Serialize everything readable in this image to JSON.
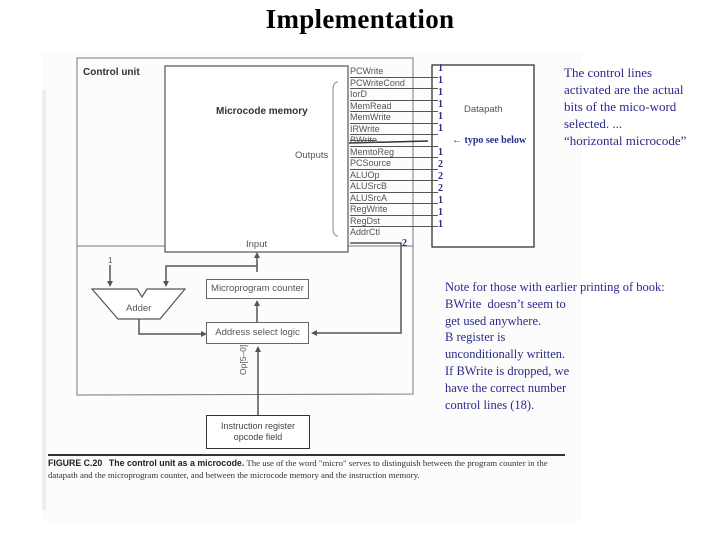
{
  "slide": {
    "title": "Implementation"
  },
  "diagram": {
    "control_unit_label": "Control unit",
    "microcode_memory_label": "Microcode memory",
    "outputs_label": "Outputs",
    "input_label": "Input",
    "datapath_label": "Datapath",
    "adder_label": "Adder",
    "adder_constant": "1",
    "microprogram_counter_label": "Microprogram counter",
    "address_select_label": "Address select logic",
    "opcode_bus_label": "Op[5–0]",
    "instruction_register_label_line1": "Instruction register",
    "instruction_register_label_line2": "opcode field",
    "addrctl_width": "2",
    "signals": [
      {
        "name": "PCWrite",
        "bits": "1",
        "struck": false
      },
      {
        "name": "PCWriteCond",
        "bits": "1",
        "struck": false
      },
      {
        "name": "IorD",
        "bits": "1",
        "struck": false
      },
      {
        "name": "MemRead",
        "bits": "1",
        "struck": false
      },
      {
        "name": "MemWrite",
        "bits": "1",
        "struck": false
      },
      {
        "name": "IRWrite",
        "bits": "1",
        "struck": false
      },
      {
        "name": "BWrite",
        "bits": "",
        "struck": true
      },
      {
        "name": "MemtoReg",
        "bits": "1",
        "struck": false
      },
      {
        "name": "PCSource",
        "bits": "2",
        "struck": false
      },
      {
        "name": "ALUOp",
        "bits": "2",
        "struck": false
      },
      {
        "name": "ALUSrcB",
        "bits": "2",
        "struck": false
      },
      {
        "name": "ALUSrcA",
        "bits": "1",
        "struck": false
      },
      {
        "name": "RegWrite",
        "bits": "1",
        "struck": false
      },
      {
        "name": "RegDst",
        "bits": "1",
        "struck": false
      },
      {
        "name": "AddrCtl",
        "bits": "",
        "struck": false
      }
    ],
    "typo_annotation": "typo see below",
    "caption": {
      "figure_label": "FIGURE C.20",
      "figure_title": "The control unit as a microcode.",
      "text": " The use of the word \"micro\" serves to distinguish between the program counter in the datapath and the microprogram counter, and between the microcode memory and the instruction memory."
    }
  },
  "notes": {
    "top_right": [
      "The control lines",
      "activated are the actual",
      "bits of the mico-word",
      "selected. ...",
      "“horizontal microcode”"
    ],
    "lower_right": [
      "Note for those with earlier printing of book:",
      "BWrite  doesn’t seem to",
      "get used anywhere.",
      "B register is",
      "unconditionally written.",
      "If BWrite is dropped, we",
      "have the correct number",
      "control lines (18)."
    ]
  },
  "colors": {
    "annotation_blue": "#2a2a8a",
    "diagram_gray": "#555555"
  }
}
